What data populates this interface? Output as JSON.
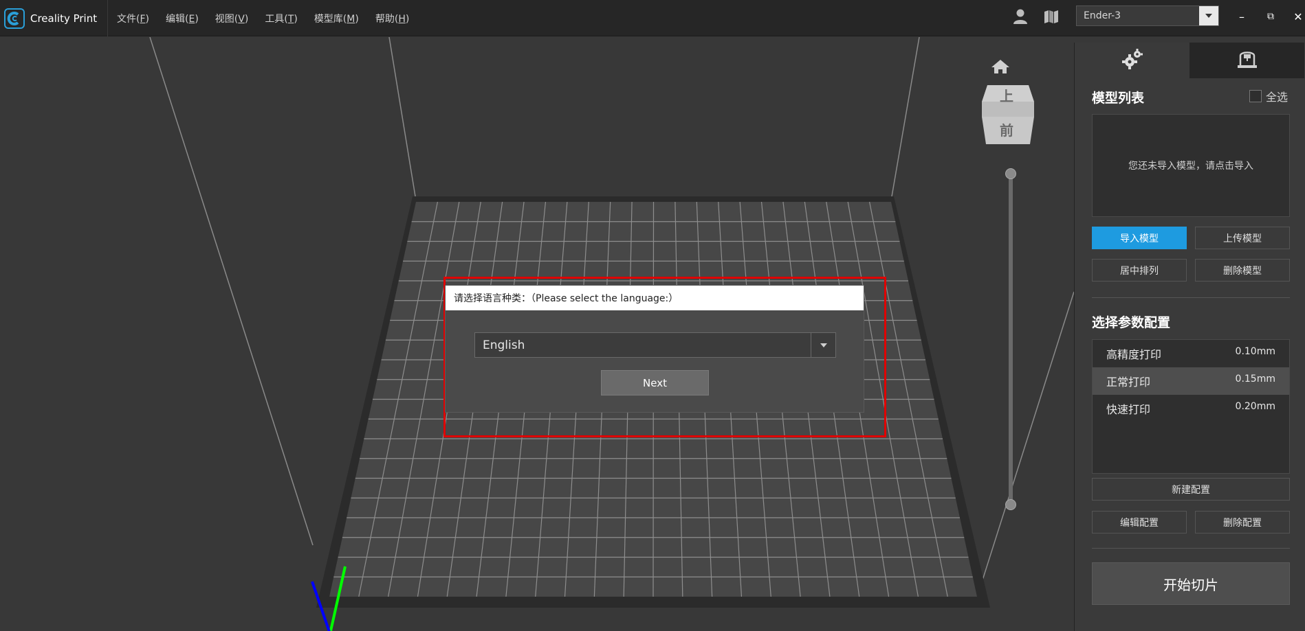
{
  "app": {
    "name": "Creality Print"
  },
  "menu": [
    {
      "label": "文件(",
      "key": "F",
      "suffix": ")"
    },
    {
      "label": "编辑(",
      "key": "E",
      "suffix": ")"
    },
    {
      "label": "视图(",
      "key": "V",
      "suffix": ")"
    },
    {
      "label": "工具(",
      "key": "T",
      "suffix": ")"
    },
    {
      "label": "模型库(",
      "key": "M",
      "suffix": ")"
    },
    {
      "label": "帮助(",
      "key": "H",
      "suffix": ")"
    }
  ],
  "printer_select": {
    "value": "Ender-3"
  },
  "window_controls": {
    "minimize": "–",
    "restore": "⧉",
    "close": "✕"
  },
  "view_cube": {
    "top": "上",
    "front": "前"
  },
  "dialog": {
    "title": "请选择语言种类：（Please select the language:）",
    "language_value": "English",
    "next_label": "Next"
  },
  "panel": {
    "model_list_title": "模型列表",
    "select_all_label": "全选",
    "model_empty_text": "您还未导入模型，请点击导入",
    "import_label": "导入模型",
    "upload_label": "上传模型",
    "center_label": "居中排列",
    "delete_model_label": "删除模型",
    "profile_title": "选择参数配置",
    "profiles": [
      {
        "name": "高精度打印",
        "value": "0.10mm"
      },
      {
        "name": "正常打印",
        "value": "0.15mm"
      },
      {
        "name": "快速打印",
        "value": "0.20mm"
      }
    ],
    "new_profile_label": "新建配置",
    "edit_profile_label": "编辑配置",
    "delete_profile_label": "删除配置",
    "slice_label": "开始切片"
  },
  "colors": {
    "accent": "#1e9be0",
    "highlight": "#e00000",
    "axis_x": "#ff0000",
    "axis_y": "#00ff00",
    "axis_z": "#0000ff"
  },
  "icons": {
    "logo": "creality-logo-icon",
    "user": "user-icon",
    "map": "map-icon",
    "home": "home-icon",
    "settings_tab": "gear-icon",
    "printer_tab": "printer-icon"
  }
}
